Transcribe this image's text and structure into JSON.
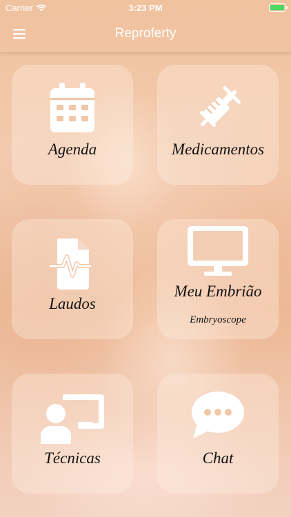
{
  "status_bar": {
    "carrier": "Carrier",
    "time": "3:23 PM",
    "wifi_icon": "wifi-icon",
    "battery_icon": "battery-charging-icon"
  },
  "navbar": {
    "title": "Reproferty",
    "menu_icon": "hamburger-menu-icon"
  },
  "tiles": [
    {
      "label": "Agenda",
      "icon": "calendar-icon"
    },
    {
      "label": "Medicamentos",
      "icon": "syringe-icon"
    },
    {
      "label": "Laudos",
      "icon": "medical-report-icon"
    },
    {
      "label": "Meu Embrião",
      "sublabel": "Embryoscope",
      "icon": "monitor-icon"
    },
    {
      "label": "Técnicas",
      "icon": "presentation-user-icon"
    },
    {
      "label": "Chat",
      "icon": "chat-bubble-icon"
    }
  ],
  "colors": {
    "background": "#f2c7a6",
    "tile": "#fff0e6",
    "icon": "#ffffff",
    "label": "#111111",
    "battery": "#4cd964"
  }
}
